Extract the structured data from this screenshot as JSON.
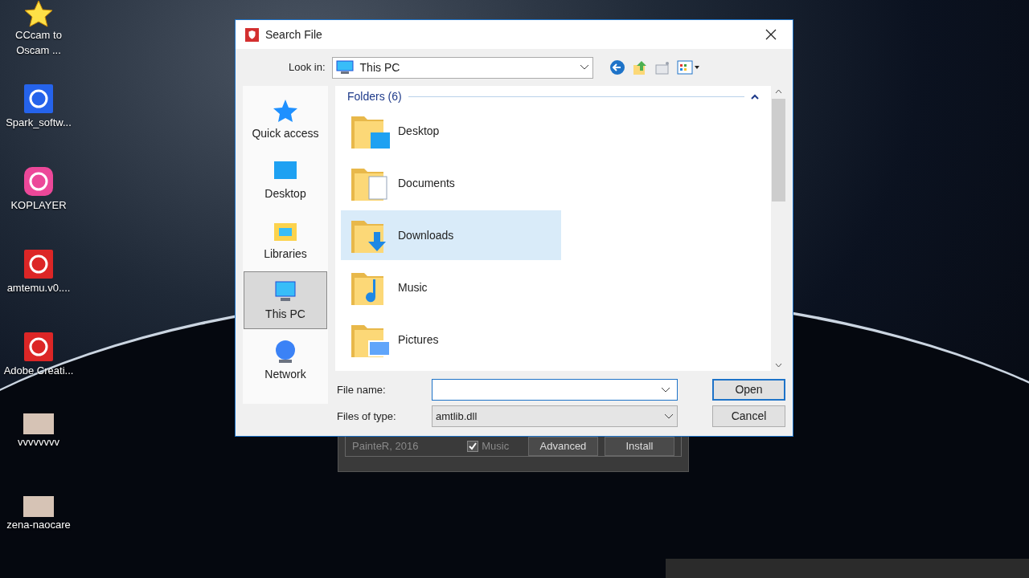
{
  "desktop_icons": [
    {
      "label": "CCcam to Oscam ...",
      "kind": "star"
    },
    {
      "label": "Spark_softw...",
      "kind": "app"
    },
    {
      "label": "KOPLAYER",
      "kind": "android"
    },
    {
      "label": "amtemu.v0....",
      "kind": "shield"
    },
    {
      "label": "Adobe Creati...",
      "kind": "adobe"
    },
    {
      "label": "vvvvvvvv",
      "kind": "photo"
    },
    {
      "label": "zena-naocare",
      "kind": "photo"
    }
  ],
  "background_window": {
    "credit": "PainteR, 2016",
    "music": {
      "label": "Music",
      "checked": true
    },
    "buttons": [
      "Advanced",
      "Install"
    ]
  },
  "dialog": {
    "title": "Search File",
    "look_in": {
      "label": "Look in:",
      "value": "This PC"
    },
    "places": [
      {
        "label": "Quick access",
        "kind": "star",
        "selected": false
      },
      {
        "label": "Desktop",
        "kind": "desktop",
        "selected": false
      },
      {
        "label": "Libraries",
        "kind": "libraries",
        "selected": false
      },
      {
        "label": "This PC",
        "kind": "pc",
        "selected": true
      },
      {
        "label": "Network",
        "kind": "network",
        "selected": false
      }
    ],
    "group_header": "Folders (6)",
    "folders": [
      {
        "name": "Desktop",
        "kind": "desktop",
        "selected": false
      },
      {
        "name": "Documents",
        "kind": "documents",
        "selected": false
      },
      {
        "name": "Downloads",
        "kind": "downloads",
        "selected": true
      },
      {
        "name": "Music",
        "kind": "music",
        "selected": false
      },
      {
        "name": "Pictures",
        "kind": "pictures",
        "selected": false
      }
    ],
    "file_name": {
      "label": "File name:"
    },
    "file_type": {
      "label": "Files of type:",
      "value": "amtlib.dll"
    },
    "buttons": [
      "Open",
      "Cancel"
    ]
  }
}
